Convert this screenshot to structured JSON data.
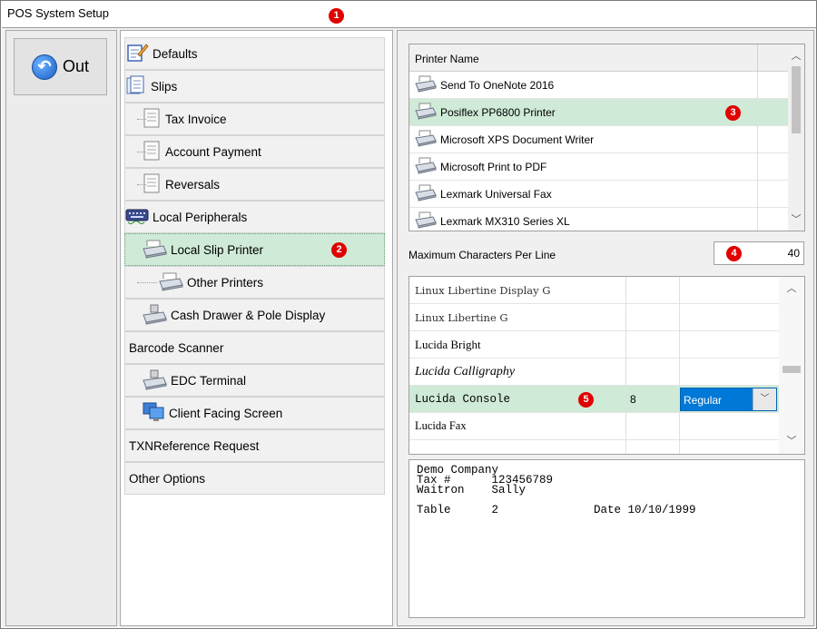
{
  "window": {
    "title": "POS System Setup"
  },
  "markers": [
    "1",
    "2",
    "3",
    "4",
    "5"
  ],
  "out_button": {
    "label": "Out"
  },
  "tree": {
    "items": [
      {
        "label": "Defaults"
      },
      {
        "label": "Slips"
      },
      {
        "label": "Tax Invoice"
      },
      {
        "label": "Account Payment"
      },
      {
        "label": "Reversals"
      },
      {
        "label": "Local Peripherals"
      },
      {
        "label": "Local Slip Printer"
      },
      {
        "label": "Other Printers"
      },
      {
        "label": "Cash Drawer & Pole Display"
      },
      {
        "label": "Barcode Scanner"
      },
      {
        "label": "EDC Terminal"
      },
      {
        "label": "Client Facing Screen"
      },
      {
        "label": "TXNReference Request"
      },
      {
        "label": "Other Options"
      }
    ]
  },
  "printers": {
    "header": "Printer Name",
    "rows": [
      {
        "name": "Send To OneNote 2016"
      },
      {
        "name": "Posiflex PP6800 Printer"
      },
      {
        "name": "Microsoft XPS Document Writer"
      },
      {
        "name": "Microsoft Print to PDF"
      },
      {
        "name": "Lexmark Universal Fax"
      },
      {
        "name": "Lexmark MX310 Series XL"
      }
    ],
    "selected": "Posiflex PP6800 Printer"
  },
  "max_chars": {
    "label": "Maximum Characters Per Line",
    "value": "40"
  },
  "fonts": {
    "rows": [
      {
        "name": "Linux Libertine Display G"
      },
      {
        "name": "Linux Libertine G"
      },
      {
        "name": "Lucida Bright"
      },
      {
        "name": "Lucida Calligraphy"
      },
      {
        "name": "Lucida Console",
        "size": "8",
        "style": "Regular"
      },
      {
        "name": "Lucida Fax"
      }
    ]
  },
  "preview": {
    "lines": [
      "Demo Company",
      "Tax #      123456789",
      "Waitron    Sally",
      "",
      "Table      2              Date 10/10/1999"
    ]
  },
  "colors": {
    "selection": "#cfead7",
    "accent": "#0078d7",
    "marker": "#e00000"
  }
}
